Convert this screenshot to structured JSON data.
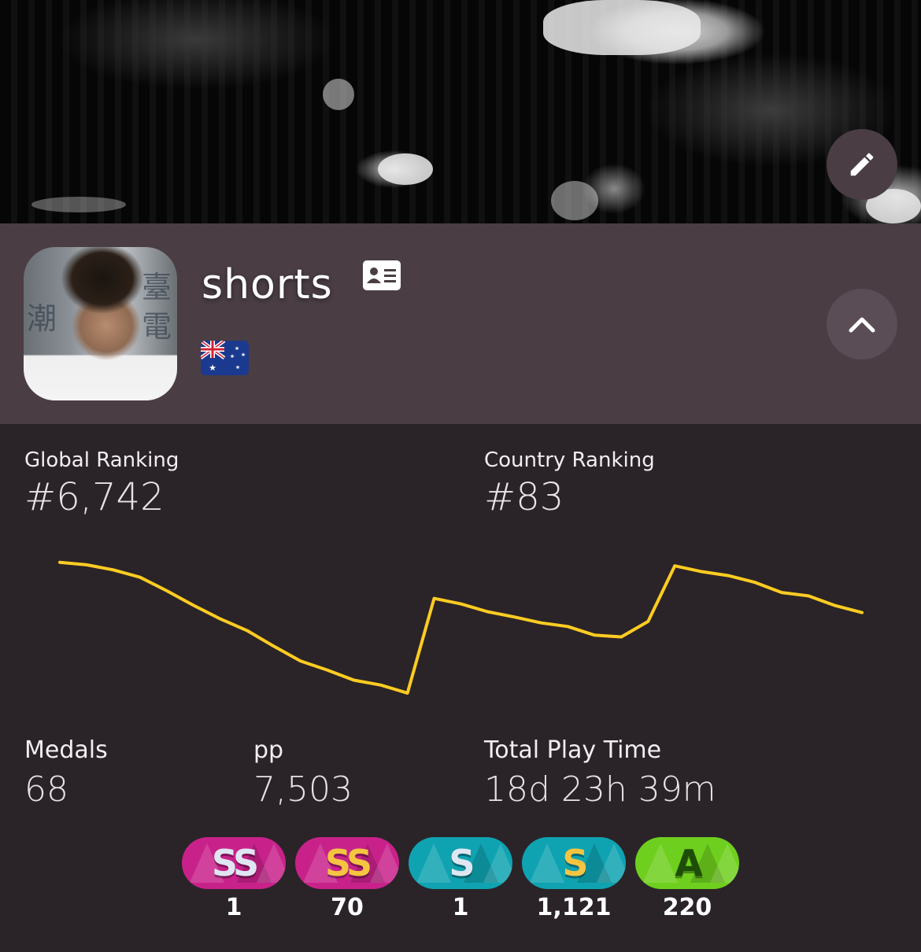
{
  "profile": {
    "username": "shorts",
    "country": "Australia"
  },
  "icons": {
    "edit": "pencil-icon",
    "profile_card": "id-card-icon",
    "collapse": "chevron-up-icon",
    "flag": "australia-flag-icon"
  },
  "stats": {
    "global_ranking_label": "Global Ranking",
    "global_ranking_value": "#6,742",
    "country_ranking_label": "Country Ranking",
    "country_ranking_value": "#83",
    "medals_label": "Medals",
    "medals_value": "68",
    "pp_label": "pp",
    "pp_value": "7,503",
    "play_time_label": "Total Play Time",
    "play_time_value": "18d 23h 39m"
  },
  "grades": [
    {
      "grade": "SS",
      "variant": "silver",
      "count": "1",
      "bg": "#c8228a",
      "fg": "#dfe6f2"
    },
    {
      "grade": "SS",
      "variant": "gold",
      "count": "70",
      "bg": "#c8228a",
      "fg": "#f5c441"
    },
    {
      "grade": "S",
      "variant": "silver",
      "count": "1",
      "bg": "#0fa3b1",
      "fg": "#dfe6f2"
    },
    {
      "grade": "S",
      "variant": "gold",
      "count": "1,121",
      "bg": "#0fa3b1",
      "fg": "#f5c441"
    },
    {
      "grade": "A",
      "variant": "normal",
      "count": "220",
      "bg": "#6fcf1e",
      "fg": "#1e4d08"
    }
  ],
  "colors": {
    "accent_line": "#ffcc22",
    "header_bg": "#4a3d44",
    "body_bg": "#2a2428"
  },
  "chart_data": {
    "type": "line",
    "title": "",
    "xlabel": "",
    "ylabel": "",
    "series": [
      {
        "values": [
          6.2,
          7.4,
          9.8,
          13.3,
          19.7,
          26.6,
          33.0,
          38.5,
          45.9,
          52.9,
          57.2,
          62.0,
          64.3,
          68.1,
          23.3,
          25.9,
          29.6,
          32.1,
          34.9,
          36.6,
          40.7,
          41.5,
          34.2,
          7.9,
          10.6,
          12.5,
          15.7,
          20.5,
          22.1,
          26.7,
          30.0
        ]
      }
    ]
  }
}
